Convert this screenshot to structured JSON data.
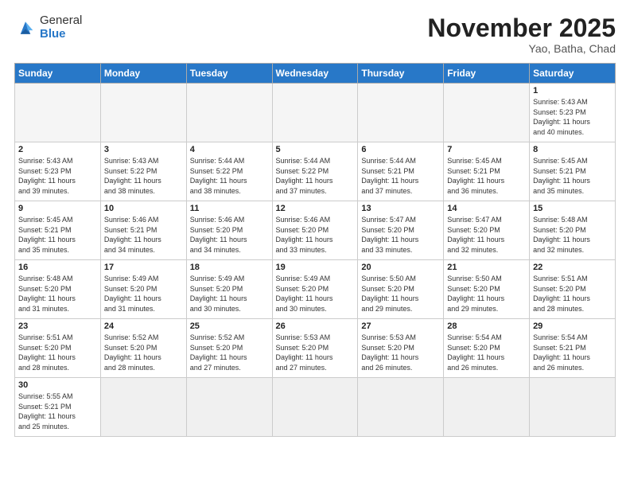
{
  "header": {
    "logo_general": "General",
    "logo_blue": "Blue",
    "month_title": "November 2025",
    "subtitle": "Yao, Batha, Chad"
  },
  "weekdays": [
    "Sunday",
    "Monday",
    "Tuesday",
    "Wednesday",
    "Thursday",
    "Friday",
    "Saturday"
  ],
  "weeks": [
    [
      {
        "day": "",
        "info": ""
      },
      {
        "day": "",
        "info": ""
      },
      {
        "day": "",
        "info": ""
      },
      {
        "day": "",
        "info": ""
      },
      {
        "day": "",
        "info": ""
      },
      {
        "day": "",
        "info": ""
      },
      {
        "day": "1",
        "info": "Sunrise: 5:43 AM\nSunset: 5:23 PM\nDaylight: 11 hours\nand 40 minutes."
      }
    ],
    [
      {
        "day": "2",
        "info": "Sunrise: 5:43 AM\nSunset: 5:23 PM\nDaylight: 11 hours\nand 39 minutes."
      },
      {
        "day": "3",
        "info": "Sunrise: 5:43 AM\nSunset: 5:22 PM\nDaylight: 11 hours\nand 38 minutes."
      },
      {
        "day": "4",
        "info": "Sunrise: 5:44 AM\nSunset: 5:22 PM\nDaylight: 11 hours\nand 38 minutes."
      },
      {
        "day": "5",
        "info": "Sunrise: 5:44 AM\nSunset: 5:22 PM\nDaylight: 11 hours\nand 37 minutes."
      },
      {
        "day": "6",
        "info": "Sunrise: 5:44 AM\nSunset: 5:21 PM\nDaylight: 11 hours\nand 37 minutes."
      },
      {
        "day": "7",
        "info": "Sunrise: 5:45 AM\nSunset: 5:21 PM\nDaylight: 11 hours\nand 36 minutes."
      },
      {
        "day": "8",
        "info": "Sunrise: 5:45 AM\nSunset: 5:21 PM\nDaylight: 11 hours\nand 35 minutes."
      }
    ],
    [
      {
        "day": "9",
        "info": "Sunrise: 5:45 AM\nSunset: 5:21 PM\nDaylight: 11 hours\nand 35 minutes."
      },
      {
        "day": "10",
        "info": "Sunrise: 5:46 AM\nSunset: 5:21 PM\nDaylight: 11 hours\nand 34 minutes."
      },
      {
        "day": "11",
        "info": "Sunrise: 5:46 AM\nSunset: 5:20 PM\nDaylight: 11 hours\nand 34 minutes."
      },
      {
        "day": "12",
        "info": "Sunrise: 5:46 AM\nSunset: 5:20 PM\nDaylight: 11 hours\nand 33 minutes."
      },
      {
        "day": "13",
        "info": "Sunrise: 5:47 AM\nSunset: 5:20 PM\nDaylight: 11 hours\nand 33 minutes."
      },
      {
        "day": "14",
        "info": "Sunrise: 5:47 AM\nSunset: 5:20 PM\nDaylight: 11 hours\nand 32 minutes."
      },
      {
        "day": "15",
        "info": "Sunrise: 5:48 AM\nSunset: 5:20 PM\nDaylight: 11 hours\nand 32 minutes."
      }
    ],
    [
      {
        "day": "16",
        "info": "Sunrise: 5:48 AM\nSunset: 5:20 PM\nDaylight: 11 hours\nand 31 minutes."
      },
      {
        "day": "17",
        "info": "Sunrise: 5:49 AM\nSunset: 5:20 PM\nDaylight: 11 hours\nand 31 minutes."
      },
      {
        "day": "18",
        "info": "Sunrise: 5:49 AM\nSunset: 5:20 PM\nDaylight: 11 hours\nand 30 minutes."
      },
      {
        "day": "19",
        "info": "Sunrise: 5:49 AM\nSunset: 5:20 PM\nDaylight: 11 hours\nand 30 minutes."
      },
      {
        "day": "20",
        "info": "Sunrise: 5:50 AM\nSunset: 5:20 PM\nDaylight: 11 hours\nand 29 minutes."
      },
      {
        "day": "21",
        "info": "Sunrise: 5:50 AM\nSunset: 5:20 PM\nDaylight: 11 hours\nand 29 minutes."
      },
      {
        "day": "22",
        "info": "Sunrise: 5:51 AM\nSunset: 5:20 PM\nDaylight: 11 hours\nand 28 minutes."
      }
    ],
    [
      {
        "day": "23",
        "info": "Sunrise: 5:51 AM\nSunset: 5:20 PM\nDaylight: 11 hours\nand 28 minutes."
      },
      {
        "day": "24",
        "info": "Sunrise: 5:52 AM\nSunset: 5:20 PM\nDaylight: 11 hours\nand 28 minutes."
      },
      {
        "day": "25",
        "info": "Sunrise: 5:52 AM\nSunset: 5:20 PM\nDaylight: 11 hours\nand 27 minutes."
      },
      {
        "day": "26",
        "info": "Sunrise: 5:53 AM\nSunset: 5:20 PM\nDaylight: 11 hours\nand 27 minutes."
      },
      {
        "day": "27",
        "info": "Sunrise: 5:53 AM\nSunset: 5:20 PM\nDaylight: 11 hours\nand 26 minutes."
      },
      {
        "day": "28",
        "info": "Sunrise: 5:54 AM\nSunset: 5:20 PM\nDaylight: 11 hours\nand 26 minutes."
      },
      {
        "day": "29",
        "info": "Sunrise: 5:54 AM\nSunset: 5:21 PM\nDaylight: 11 hours\nand 26 minutes."
      }
    ],
    [
      {
        "day": "30",
        "info": "Sunrise: 5:55 AM\nSunset: 5:21 PM\nDaylight: 11 hours\nand 25 minutes."
      },
      {
        "day": "",
        "info": ""
      },
      {
        "day": "",
        "info": ""
      },
      {
        "day": "",
        "info": ""
      },
      {
        "day": "",
        "info": ""
      },
      {
        "day": "",
        "info": ""
      },
      {
        "day": "",
        "info": ""
      }
    ]
  ]
}
